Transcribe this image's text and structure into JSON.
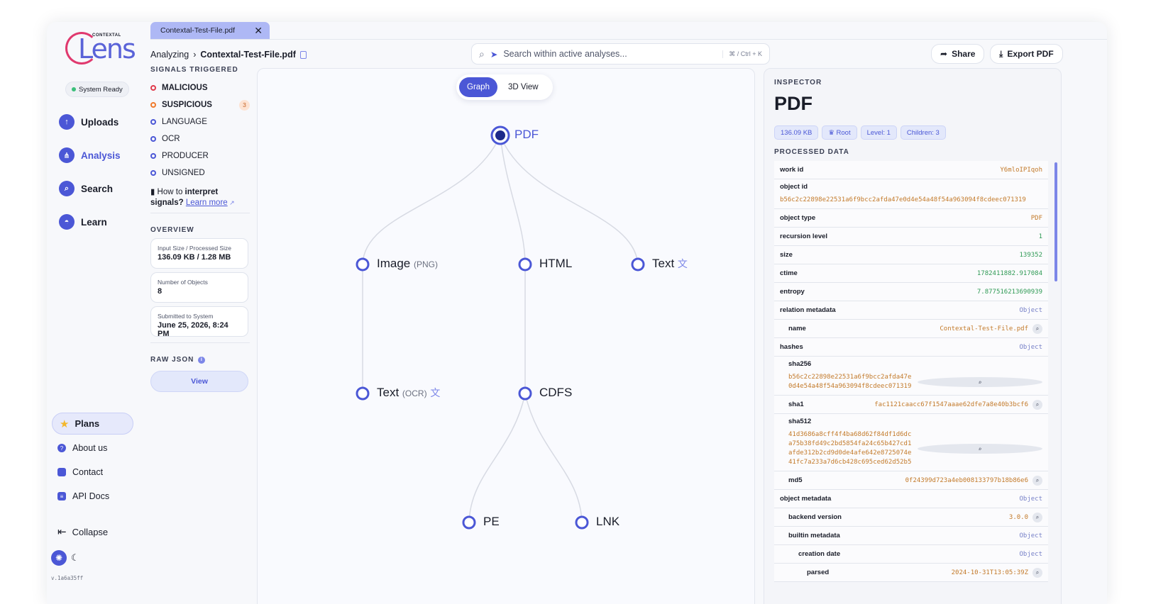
{
  "sidebar": {
    "brand_small": "CONTEXTAL",
    "brand_big": "Lens",
    "status": "System Ready",
    "nav": [
      {
        "label": "Uploads",
        "icon": "upload-icon"
      },
      {
        "label": "Analysis",
        "icon": "analysis-icon",
        "active": true
      },
      {
        "label": "Search",
        "icon": "search-icon"
      },
      {
        "label": "Learn",
        "icon": "learn-icon"
      }
    ],
    "plans": "Plans",
    "links": [
      {
        "label": "About us",
        "icon": "question-icon"
      },
      {
        "label": "Contact",
        "icon": "chat-icon"
      },
      {
        "label": "API Docs",
        "icon": "docs-icon"
      }
    ],
    "collapse": "Collapse",
    "version": "v.1a6a35ff"
  },
  "tab": {
    "label": "Contextal-Test-File.pdf"
  },
  "breadcrumb": {
    "root": "Analyzing",
    "file": "Contextal-Test-File.pdf"
  },
  "search": {
    "placeholder": "Search within active analyses...",
    "shortcut": "⌘ / Ctrl + K"
  },
  "actions": {
    "share": "Share",
    "export": "Export PDF"
  },
  "signals": {
    "heading": "SIGNALS TRIGGERED",
    "items": [
      {
        "label": "MALICIOUS",
        "color": "red",
        "bold": true
      },
      {
        "label": "SUSPICIOUS",
        "color": "orange",
        "bold": true,
        "count": "3"
      },
      {
        "label": "LANGUAGE",
        "color": "blue"
      },
      {
        "label": "OCR",
        "color": "blue"
      },
      {
        "label": "PRODUCER",
        "color": "blue"
      },
      {
        "label": "UNSIGNED",
        "color": "blue"
      }
    ],
    "howto_pre": "How to ",
    "howto_bold1": "interpret",
    "howto_bold2": "signals?",
    "learn_more": "Learn more"
  },
  "overview": {
    "heading": "OVERVIEW",
    "cards": [
      {
        "label": "Input Size / Processed Size",
        "value": "136.09 KB / 1.28 MB"
      },
      {
        "label": "Number of Objects",
        "value": "8"
      },
      {
        "label": "Submitted to System",
        "value": "June 25, 2026, 8:24 PM"
      }
    ]
  },
  "raw_json": {
    "heading": "RAW JSON",
    "button": "View"
  },
  "graph": {
    "toggle": [
      "Graph",
      "3D View"
    ],
    "nodes": {
      "pdf": "PDF",
      "image": "Image",
      "image_sub": "(PNG)",
      "html": "HTML",
      "text": "Text",
      "text_ocr": "Text",
      "text_ocr_sub": "(OCR)",
      "cdfs": "CDFS",
      "pe": "PE",
      "lnk": "LNK"
    }
  },
  "inspector": {
    "heading": "INSPECTOR",
    "title": "PDF",
    "chips": [
      "136.09 KB",
      "♛ Root",
      "Level: 1",
      "Children: 3"
    ],
    "processed_heading": "PROCESSED DATA",
    "rows": {
      "work_id_k": "work id",
      "work_id_v": "Y6mloIPIqoh",
      "object_id_k": "object id",
      "object_id_v": "b56c2c22898e22531a6f9bcc2afda47e0d4e54a48f54a963094f8cdeec071319",
      "object_type_k": "object type",
      "object_type_v": "PDF",
      "recursion_k": "recursion level",
      "recursion_v": "1",
      "size_k": "size",
      "size_v": "139352",
      "ctime_k": "ctime",
      "ctime_v": "1782411882.917084",
      "entropy_k": "entropy",
      "entropy_v": "7.877516213690939",
      "relation_k": "relation metadata",
      "relation_v": "Object",
      "name_k": "name",
      "name_v": "Contextal-Test-File.pdf",
      "hashes_k": "hashes",
      "hashes_v": "Object",
      "sha256_k": "sha256",
      "sha256_v": "b56c2c22898e22531a6f9bcc2afda47e0d4e54a48f54a963094f8cdeec071319",
      "sha1_k": "sha1",
      "sha1_v": "fac1121caacc67f1547aaae62dfe7a8e40b3bcf6",
      "sha512_k": "sha512",
      "sha512_v": "41d3686a8cff4f4ba68d62f84df1d6dca75b38fd49c2bd5854fa24c65b427cd1afde312b2cd9d0de4afe642e8725074e41fc7a233a7d6cb428c695ced62d52b5",
      "md5_k": "md5",
      "md5_v": "0f24399d723a4eb008133797b18b86e6",
      "objmeta_k": "object metadata",
      "objmeta_v": "Object",
      "backend_k": "backend version",
      "backend_v": "3.0.0",
      "builtin_k": "builtin metadata",
      "builtin_v": "Object",
      "creation_k": "creation date",
      "creation_v": "Object",
      "parsed_k": "parsed",
      "parsed_v": "2024-10-31T13:05:39Z"
    }
  }
}
